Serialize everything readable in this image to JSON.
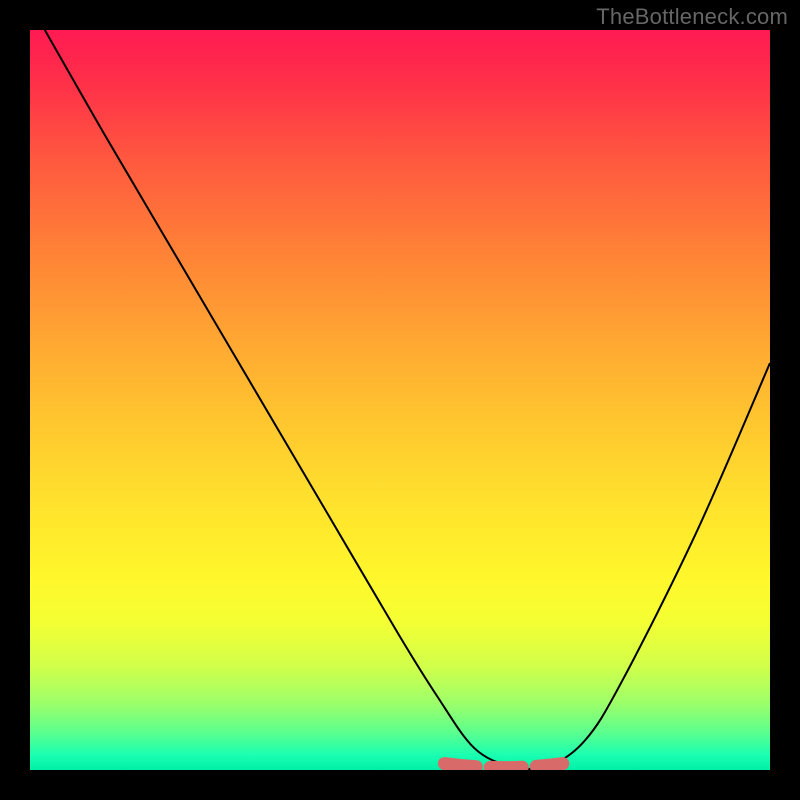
{
  "watermark": "TheBottleneck.com",
  "chart_data": {
    "type": "line",
    "title": "",
    "xlabel": "",
    "ylabel": "",
    "xlim": [
      0,
      100
    ],
    "ylim": [
      0,
      100
    ],
    "x": [
      2,
      10,
      20,
      30,
      40,
      50,
      55,
      60,
      65,
      70,
      75,
      80,
      90,
      100
    ],
    "values": [
      100,
      86,
      69,
      52,
      35,
      18,
      10,
      3,
      0.5,
      0.5,
      4,
      12,
      32,
      55
    ],
    "flat_band": {
      "x_start": 56,
      "x_end": 72,
      "y": 0.6
    },
    "gradient_stops": [
      {
        "pos": 0,
        "color": "#ff1a52"
      },
      {
        "pos": 50,
        "color": "#ffc42f"
      },
      {
        "pos": 80,
        "color": "#fff72b"
      },
      {
        "pos": 100,
        "color": "#00f0a8"
      }
    ]
  }
}
